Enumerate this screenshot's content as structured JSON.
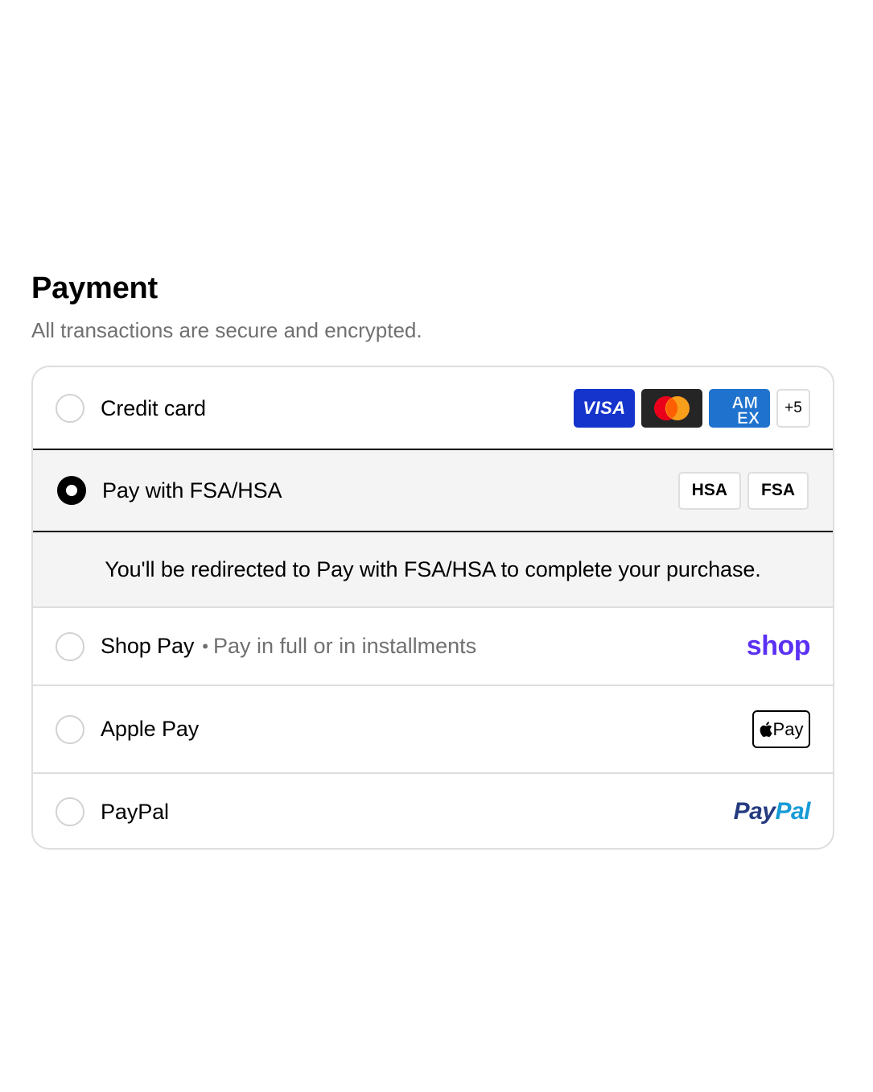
{
  "header": {
    "title": "Payment",
    "subtitle": "All transactions are secure and encrypted."
  },
  "options": {
    "credit_card": {
      "label": "Credit card",
      "cards": [
        "VISA",
        "mastercard",
        "AMEX"
      ],
      "more": "+5",
      "selected": false
    },
    "fsa_hsa": {
      "label": "Pay with FSA/HSA",
      "tags": [
        "HSA",
        "FSA"
      ],
      "selected": true,
      "note": "You'll be redirected to Pay with FSA/HSA to complete your purchase."
    },
    "shop_pay": {
      "label": "Shop Pay",
      "separator": "•",
      "sublabel": "Pay in full or in installments",
      "logo": "shop",
      "selected": false
    },
    "apple_pay": {
      "label": "Apple Pay",
      "badge_text": "Pay",
      "selected": false
    },
    "paypal": {
      "label": "PayPal",
      "logo_part1": "Pay",
      "logo_part2": "Pal",
      "selected": false
    }
  },
  "colors": {
    "visa": "#1434cb",
    "mastercard_red": "#eb001b",
    "mastercard_orange": "#f79e1b",
    "amex": "#1f72cd",
    "shop": "#5a31f4",
    "paypal_dark": "#253b80",
    "paypal_light": "#179bd7"
  }
}
